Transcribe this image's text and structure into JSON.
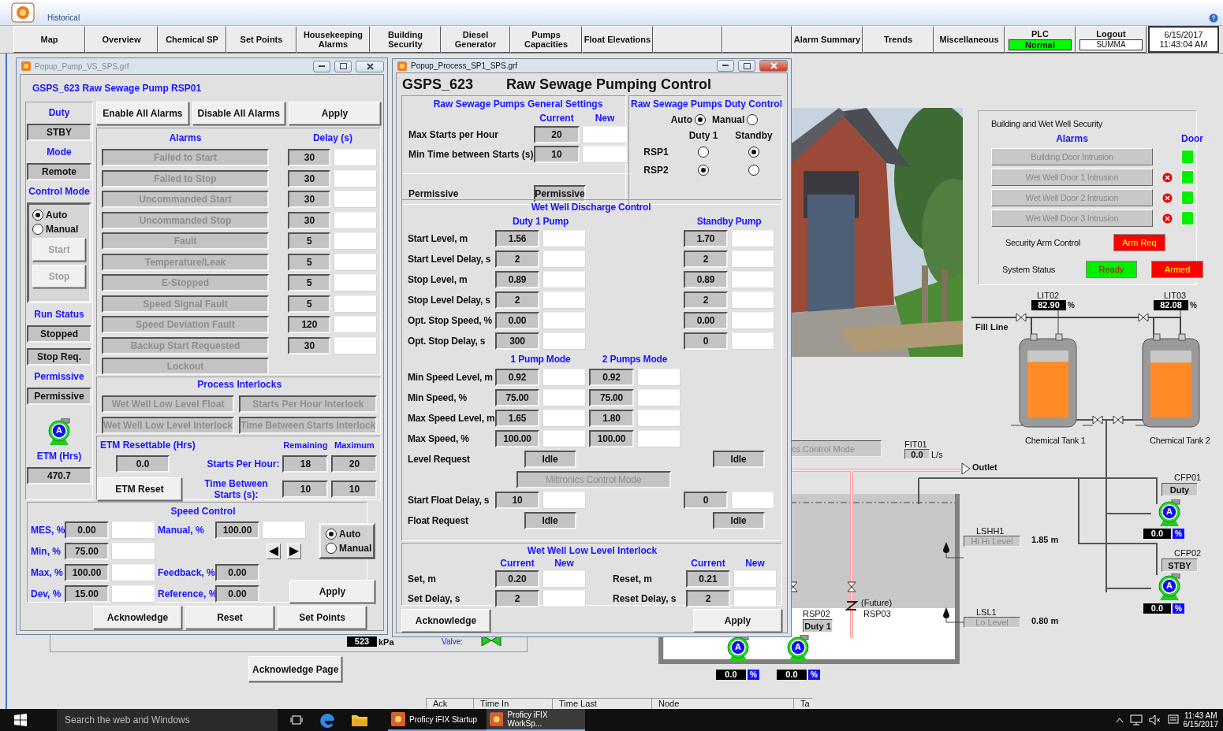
{
  "app_bar": {
    "label": "Historical"
  },
  "nav": [
    {
      "kind": "button",
      "label": "Map"
    },
    {
      "kind": "button",
      "label": "Overview"
    },
    {
      "kind": "button",
      "label": "Chemical SP"
    },
    {
      "kind": "button",
      "label": "Set Points"
    },
    {
      "kind": "button",
      "label": "Housekeeping Alarms"
    },
    {
      "kind": "button",
      "label": "Building Security"
    },
    {
      "kind": "button",
      "label": "Diesel Generator"
    },
    {
      "kind": "button",
      "label": "Pumps Capacities"
    },
    {
      "kind": "button",
      "label": "Float Elevations"
    },
    {
      "kind": "blank"
    },
    {
      "kind": "blank"
    },
    {
      "kind": "button",
      "label": "Alarm Summary"
    },
    {
      "kind": "button",
      "label": "Trends"
    },
    {
      "kind": "button",
      "label": "Miscellaneous"
    },
    {
      "kind": "status",
      "label": "PLC",
      "value": "Normal"
    },
    {
      "kind": "user",
      "label": "Logout",
      "value": "SUMMA"
    },
    {
      "kind": "clock",
      "date": "6/15/2017",
      "time": "11:43:04 AM"
    }
  ],
  "pump_popup": {
    "title": "Popup_Pump_VS_SPS.grf",
    "heading": "GSPS_623 Raw Sewage Pump RSP01",
    "duty": {
      "label": "Duty",
      "value": "STBY"
    },
    "mode": {
      "label": "Mode",
      "value": "Remote"
    },
    "control_mode": {
      "label": "Control Mode",
      "options": [
        {
          "label": "Auto",
          "selected": true
        },
        {
          "label": "Manual",
          "selected": false
        }
      ],
      "start": {
        "label": "Start",
        "disabled": true
      },
      "stop": {
        "label": "Stop",
        "disabled": true
      }
    },
    "run_status": {
      "label": "Run Status",
      "value": "Stopped",
      "request": "Stop Req."
    },
    "permissive": {
      "label": "Permissive",
      "value": "Permissive"
    },
    "pump": {
      "letter": "A"
    },
    "etm": {
      "label": "ETM (Hrs)",
      "value": "470.7"
    },
    "top_buttons": [
      "Enable All Alarms",
      "Disable All Alarms",
      "Apply"
    ],
    "alarms": {
      "header": "Alarms",
      "delay_header": "Delay (s)",
      "rows": [
        {
          "label": "Failed to Start",
          "delay": "30"
        },
        {
          "label": "Failed to Stop",
          "delay": "30"
        },
        {
          "label": "Uncommanded Start",
          "delay": "30"
        },
        {
          "label": "Uncommanded Stop",
          "delay": "30"
        },
        {
          "label": "Fault",
          "delay": "5"
        },
        {
          "label": "Temperature/Leak",
          "delay": "5"
        },
        {
          "label": "E-Stopped",
          "delay": "5"
        },
        {
          "label": "Speed Signal Fault",
          "delay": "5"
        },
        {
          "label": "Speed Deviation Fault",
          "delay": "120"
        },
        {
          "label": "Backup Start Requested",
          "delay": "30"
        },
        {
          "label": "Lockout"
        }
      ]
    },
    "interlocks": {
      "title": "Process Interlocks",
      "items": [
        "Wet Well Low Level Float",
        "Starts Per Hour Interlock",
        "Wet Well Low Level Interlock",
        "Time Between Starts  Interlock"
      ]
    },
    "etm_resettable": {
      "label": "ETM Resettable (Hrs)",
      "value": "0.0",
      "button": "ETM Reset"
    },
    "starts": {
      "remaining_header": "Remaining",
      "maximum_header": "Maximum",
      "rows": [
        {
          "label": "Starts Per Hour:",
          "remaining": "18",
          "maximum": "20"
        },
        {
          "label": "Time Between Starts (s):",
          "remaining": "10",
          "maximum": "10"
        }
      ]
    },
    "speed_control": {
      "title": "Speed Control",
      "limits": [
        {
          "label": "MES, %",
          "current": "0.00"
        },
        {
          "label": "Min, %",
          "current": "75.00"
        },
        {
          "label": "Max, %",
          "current": "100.00"
        },
        {
          "label": "Dev, %",
          "current": "15.00"
        }
      ],
      "manual": {
        "label": "Manual, %",
        "current": "100.00"
      },
      "feedback": {
        "label": "Feedback, %",
        "value": "0.00"
      },
      "reference": {
        "label": "Reference, %",
        "value": "0.00"
      },
      "options": [
        {
          "label": "Auto",
          "selected": true
        },
        {
          "label": "Manual",
          "selected": false
        }
      ],
      "apply": "Apply"
    },
    "footer_buttons": [
      "Acknowledge",
      "Reset",
      "Set Points"
    ]
  },
  "process_popup": {
    "title": "Popup_Process_SP1_SPS.grf",
    "code": "GSPS_623",
    "heading": "Raw Sewage Pumping Control",
    "general": {
      "title": "Raw Sewage Pumps General Settings",
      "current_header": "Current",
      "new_header": "New",
      "rows": [
        {
          "label": "Max Starts per Hour",
          "current": "20"
        },
        {
          "label": "Min Time between Starts (s)",
          "current": "10"
        }
      ],
      "permissive": {
        "label": "Permissive",
        "value": "Permissive"
      }
    },
    "duty_control": {
      "title": "Raw Sewage Pumps Duty Control",
      "modes": [
        {
          "label": "Auto",
          "selected": true
        },
        {
          "label": "Manual",
          "selected": false
        }
      ],
      "duty_header": "Duty 1",
      "standby_header": "Standby",
      "pumps": [
        {
          "label": "RSP1",
          "duty": false,
          "standby": true
        },
        {
          "label": "RSP2",
          "duty": true,
          "standby": false
        }
      ]
    },
    "discharge": {
      "title": "Wet Well Discharge Control",
      "duty_header": "Duty 1 Pump",
      "standby_header": "Standby Pump",
      "settings": [
        {
          "label": "Start Level, m",
          "duty": "1.56",
          "standby": "1.70"
        },
        {
          "label": "Start Level Delay, s",
          "duty": "2",
          "standby": "2"
        },
        {
          "label": "Stop Level, m",
          "duty": "0.89",
          "standby": "0.89"
        },
        {
          "label": "Stop Level Delay, s",
          "duty": "2",
          "standby": "2"
        },
        {
          "label": "Opt. Stop Speed, %",
          "duty": "0.00",
          "standby": "0.00"
        },
        {
          "label": "Opt. Stop Delay, s",
          "duty": "300",
          "standby": "0"
        }
      ],
      "one_pump_header": "1 Pump Mode",
      "two_pumps_header": "2 Pumps Mode",
      "mode_settings": [
        {
          "label": "Min Speed Level, m",
          "one_pump": "0.92",
          "two_pumps": "0.92"
        },
        {
          "label": "Min Speed, %",
          "one_pump": "75.00",
          "two_pumps": "75.00"
        },
        {
          "label": "Max Speed Level, m",
          "one_pump": "1.65",
          "two_pumps": "1.80"
        },
        {
          "label": "Max Speed, %",
          "one_pump": "100.00",
          "two_pumps": "100.00"
        }
      ],
      "level_request": {
        "label": "Level Request",
        "duty": "Idle",
        "standby": "Idle"
      },
      "miltronics": "Miltronics Control Mode",
      "start_float_delay": {
        "label": "Start Float Delay, s",
        "duty": "10",
        "standby": "0"
      },
      "float_request": {
        "label": "Float Request",
        "duty": "Idle",
        "standby": "Idle"
      }
    },
    "interlock": {
      "title": "Wet Well Low Level Interlock",
      "left_current_header": "Current",
      "left_new_header": "New",
      "right_current_header": "Current",
      "right_new_header": "New",
      "left": [
        {
          "label": "Set, m",
          "current": "0.20"
        },
        {
          "label": "Set Delay, s",
          "current": "2"
        }
      ],
      "right": [
        {
          "label": "Reset, m",
          "current": "0.21"
        },
        {
          "label": "Reset Delay, s",
          "current": "2"
        }
      ]
    },
    "buttons": [
      "Acknowledge",
      "Apply"
    ]
  },
  "background": {
    "pressure": "523",
    "pressure_unit": "kPa",
    "valve_label": "Valve:",
    "acknowledge_page": "Acknowledge Page",
    "alarm_columns": [
      "Ack",
      "Time In",
      "Time Last",
      "Node",
      "Ta"
    ]
  },
  "security": {
    "title": "Building and Wet Well Security",
    "alarms_header": "Alarms",
    "door_header": "Door",
    "rows": [
      {
        "label": "Building Door Intrusion",
        "fault": false,
        "door_ok": true
      },
      {
        "label": "Wet Well  Door 1 Intrusion",
        "fault": true,
        "door_ok": true
      },
      {
        "label": "Wet Well  Door 2 Intrusion",
        "fault": true,
        "door_ok": true
      },
      {
        "label": "Wet Well  Door 3 Intrusion",
        "fault": true,
        "door_ok": true
      }
    ],
    "arm_label": "Security Arm Control",
    "arm_button": "Arm Req",
    "status_label": "System Status",
    "statuses": [
      {
        "label": "Ready",
        "kind": "ok"
      },
      {
        "label": "Armed",
        "kind": "alarm"
      }
    ]
  },
  "diagram": {
    "fill_line": "Fill Line",
    "tanks": [
      {
        "name": "Chemical Tank 1",
        "tag": "LIT02",
        "reading": "82.90",
        "unit": "%",
        "level": 0.83
      },
      {
        "name": "Chemical Tank 2",
        "tag": "LIT03",
        "reading": "82.08",
        "unit": "%",
        "level": 0.82
      }
    ],
    "feed_pumps": [
      {
        "tag": "CFP01",
        "state": "Duty",
        "letter": "A",
        "speed": "0.0",
        "unit": "%"
      },
      {
        "tag": "CFP02",
        "state": "STBY",
        "letter": "A",
        "speed": "0.0",
        "unit": "%"
      }
    ],
    "control_mode_button": "cs Control Mode",
    "flow": {
      "tag": "FIT01",
      "value": "0.0",
      "unit": "L/s"
    },
    "outlet": "Outlet",
    "switches": [
      {
        "tag": "LSHH1",
        "state": "Hi Hi Level",
        "elevation": "1.85 m"
      },
      {
        "tag": "LSL1",
        "state": "Lo Level",
        "elevation": "0.80 m"
      }
    ],
    "rsp02": {
      "tag": "RSP02",
      "state": "Duty 1"
    },
    "rsp03": {
      "note": "(Future)",
      "tag": "RSP03"
    },
    "well_pumps": [
      {
        "letter": "A",
        "speed": "0.0",
        "unit": "%"
      },
      {
        "letter": "A",
        "speed": "0.0",
        "unit": "%"
      }
    ]
  },
  "taskbar": {
    "search": "Search the web and Windows",
    "apps": [
      {
        "label": "Proficy iFIX Startup",
        "selected": false
      },
      {
        "label": "Proficy iFIX WorkSp...",
        "selected": true
      }
    ],
    "time": "11:43 AM",
    "date": "6/15/2017"
  }
}
